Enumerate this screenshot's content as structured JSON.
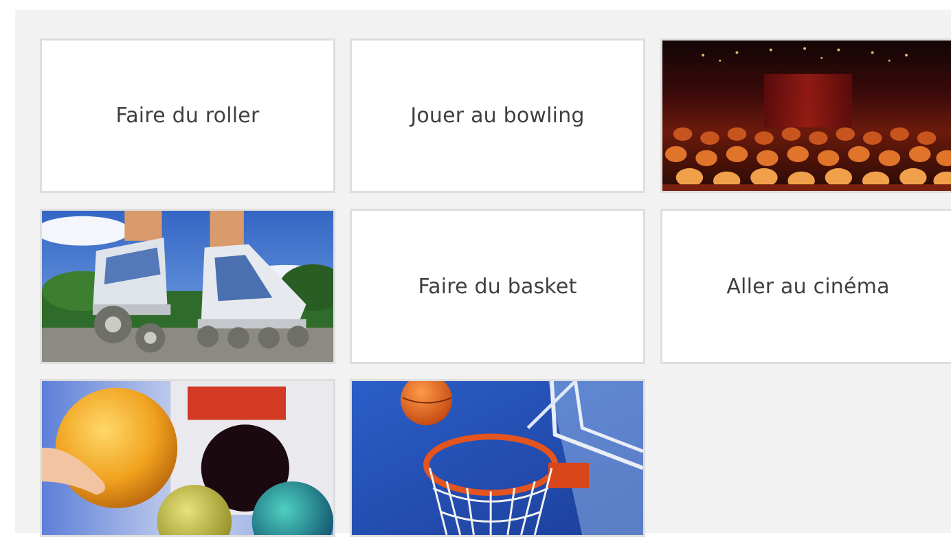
{
  "cards": [
    {
      "label": "Faire du roller"
    },
    {
      "label": "Jouer au bowling"
    },
    {
      "image": "cinema-audience-photo"
    },
    {
      "image": "rollerblades-photo"
    },
    {
      "label": "Faire du basket"
    },
    {
      "label": "Aller au cinéma"
    },
    {
      "image": "bowling-balls-photo"
    },
    {
      "image": "basketball-hoop-photo"
    }
  ],
  "colors": {
    "background": "#f2f2f2",
    "card": "#ffffff",
    "card_border": "#dedede",
    "label_text": "#3f3f3f"
  }
}
